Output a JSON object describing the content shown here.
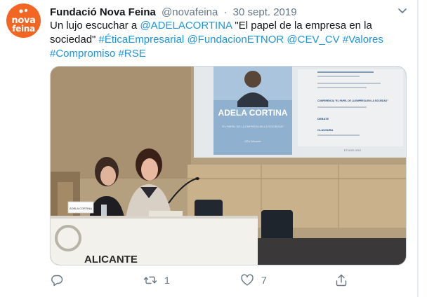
{
  "author": {
    "name": "Fundació Nova Feina",
    "handle": "@novafeina",
    "separator": "·",
    "date": "30 sept. 2019",
    "avatar_text_top": "nova",
    "avatar_text_bottom": "feina",
    "avatar_color": "#f26522"
  },
  "tweet": {
    "text_plain_1": "Un lujo escuchar a ",
    "mention_1": "@ADELACORTINA",
    "text_plain_2": " \"El papel de la empresa en la sociedad\" ",
    "tag_1": "#ÉticaEmpresarial",
    "mention_2": "@FundacionETNOR",
    "mention_3": "@CEV_CV",
    "tag_2": "#Valores",
    "tag_3": "#Compromiso",
    "tag_4": "#RSE"
  },
  "media": {
    "slide_name": "ADELA CORTINA",
    "slide_subtitle": "\"EL PAPEL DE LA EMPRESA EN LA SOCIEDAD\"",
    "slide_event": "CEV Alicante",
    "slide_right_heading": "CONFERENCIA \"EL PAPEL DE LA EMPRESA EN LA SOCIEDAD\"",
    "slide_right_item_1": "DEBATE",
    "slide_right_item_2": "CLAUSURA",
    "slide_footer": "ETNOR.ORG",
    "nameplate": "ADELA CORTINA",
    "sign_text": "ALICANTE"
  },
  "actions": {
    "reply_count": "",
    "retweet_count": "1",
    "like_count": "7"
  },
  "colors": {
    "link": "#1b95e0",
    "text": "#14171a",
    "muted": "#657786",
    "accent": "#f26522"
  }
}
